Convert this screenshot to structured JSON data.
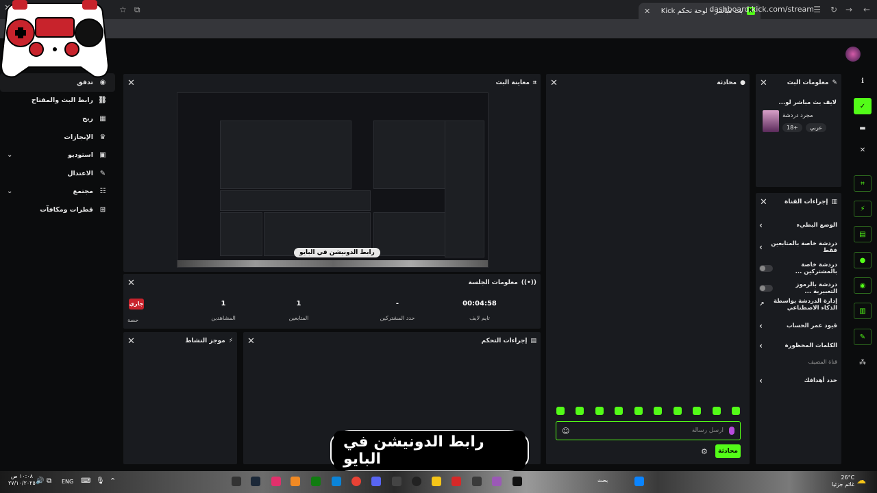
{
  "browser": {
    "tab_title": "بث مباشر - لوحة تحكم Kick",
    "tab_favicon": "K",
    "url": "dashboard.kick.com/stream"
  },
  "sidebar": {
    "items": [
      {
        "label": "تدفق",
        "icon": "stream-icon"
      },
      {
        "label": "رابط البث والمفتاح",
        "icon": "link-icon"
      },
      {
        "label": "ربح",
        "icon": "monetize-icon"
      },
      {
        "label": "الإنجازات",
        "icon": "trophy-icon"
      },
      {
        "label": "استوديو",
        "icon": "studio-icon",
        "expandable": true
      },
      {
        "label": "الاعتدال",
        "icon": "wrench-icon"
      },
      {
        "label": "مجتمع",
        "icon": "community-icon",
        "expandable": true
      },
      {
        "label": "قطرات ومكافآت",
        "icon": "drops-icon"
      }
    ]
  },
  "preview": {
    "title": "معاينة البث",
    "caption": "رابط الدونيشن في البايو"
  },
  "session": {
    "title": "معلومات الجلسة",
    "status_badge": "جاري",
    "stats": [
      {
        "value": "00:04:58",
        "label": "تايم لايف"
      },
      {
        "value": "-",
        "label": "حدد المشتركين"
      },
      {
        "value": "1",
        "label": "المتابعين"
      },
      {
        "value": "1",
        "label": "المشاهدين"
      },
      {
        "value": "",
        "label": "حصة"
      }
    ]
  },
  "activity": {
    "title": "موجز النشاط"
  },
  "moderation": {
    "title": "إجراءات التحكم"
  },
  "chat": {
    "title": "محادثة",
    "placeholder": "ارسل رسالة",
    "send_label": "محادثة"
  },
  "stream_info": {
    "title": "معلومات البث",
    "stream_title": "لايف بث مباشر لو...",
    "category": "مجرد دردشة",
    "tags": [
      "عربي",
      "18+"
    ]
  },
  "channel_actions": {
    "title": "إجراءات القناة",
    "items": [
      {
        "label": "الوضع البطيء",
        "control": "chevron"
      },
      {
        "label": "دردشة خاصة بالمتابعين فقط",
        "control": "chevron"
      },
      {
        "label": "دردشة خاصة بالمشتركين ...",
        "control": "toggle"
      },
      {
        "label": "دردشة بالرموز التعبيرية ...",
        "control": "toggle"
      },
      {
        "label": "إدارة الدردشة بواسطة الذكاء الاصطناعي",
        "control": "external"
      },
      {
        "label": "قيود عمر الحساب",
        "control": "chevron"
      },
      {
        "label": "الكلمات المحظورة",
        "control": "chevron"
      },
      {
        "label": "قناة المضيف",
        "control": "none"
      },
      {
        "label": "حدد أهدافك",
        "control": "chevron"
      }
    ]
  },
  "overlay_caption": "رابط الدونيشن في البايو",
  "taskbar": {
    "clock_time": "١٠:٠٨ ص",
    "clock_date": "٢٧/١٠/٢٠٢٥",
    "lang": "ENG",
    "weather_temp": "26°C",
    "weather_desc": "غائم جزئيا",
    "search_label": "بحث"
  },
  "colors": {
    "accent": "#53fc18",
    "live": "#c8232c",
    "panel": "#191b1f",
    "bg": "#0b0c0d"
  }
}
